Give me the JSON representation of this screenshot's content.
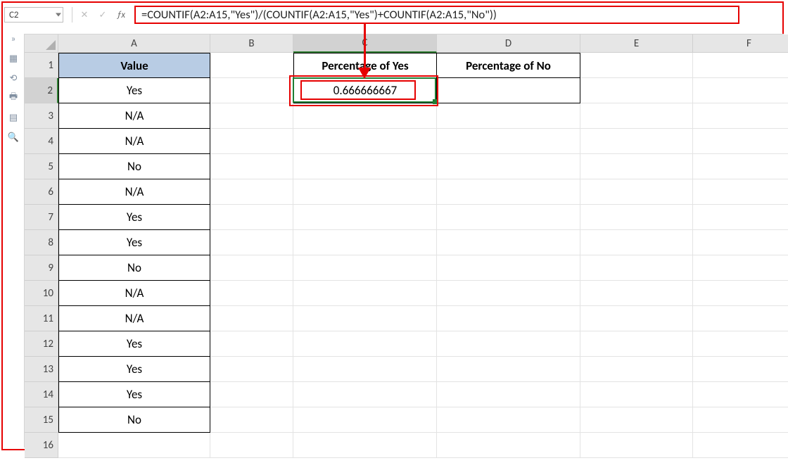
{
  "name_box": "C2",
  "formula": "=COUNTIF(A2:A15,\"Yes\")/(COUNTIF(A2:A15,\"Yes\")+COUNTIF(A2:A15,\"No\"))",
  "columns": [
    "A",
    "B",
    "C",
    "D",
    "E",
    "F"
  ],
  "row_count": 16,
  "active_cell": "C2",
  "headers": {
    "A1": "Value",
    "C1": "Percentage of Yes",
    "D1": "Percentage of No"
  },
  "colA": [
    "Yes",
    "N/A",
    "N/A",
    "No",
    "N/A",
    "Yes",
    "Yes",
    "No",
    "N/A",
    "N/A",
    "Yes",
    "Yes",
    "Yes",
    "No"
  ],
  "C2": "0.666666667",
  "fbar_buttons": {
    "cancel": "✕",
    "confirm": "✓",
    "fx": "ƒx"
  },
  "side_icons": [
    "»",
    "▦",
    "⟲",
    "🖶",
    "▤",
    "🔍"
  ],
  "chart_data": {
    "type": "table",
    "title": "Excel worksheet showing COUNTIF percentage calculation",
    "columns": [
      "Value",
      "Percentage of Yes",
      "Percentage of No"
    ],
    "data_col_A": [
      "Yes",
      "N/A",
      "N/A",
      "No",
      "N/A",
      "Yes",
      "Yes",
      "No",
      "N/A",
      "N/A",
      "Yes",
      "Yes",
      "Yes",
      "No"
    ],
    "result_C2": 0.666666667,
    "formula_C2": "=COUNTIF(A2:A15,\"Yes\")/(COUNTIF(A2:A15,\"Yes\")+COUNTIF(A2:A15,\"No\"))"
  }
}
